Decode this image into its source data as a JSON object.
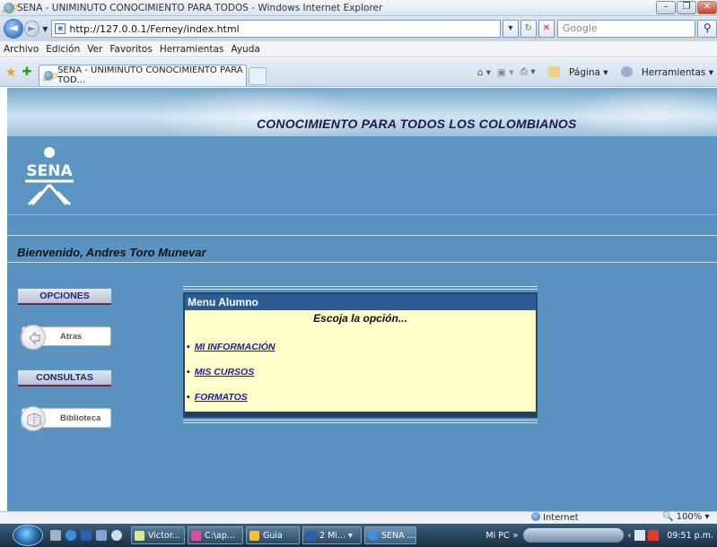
{
  "window": {
    "title": "SENA - UNIMINUTO CONOCIMIENTO PARA TODOS - Windows Internet Explorer",
    "minimize": "–",
    "maximize": "❐",
    "close": "✕"
  },
  "address_bar": {
    "url": "http://127.0.0.1/Ferney/index.html",
    "search_placeholder": "Google"
  },
  "menu": {
    "items": [
      "Archivo",
      "Edición",
      "Ver",
      "Favoritos",
      "Herramientas",
      "Ayuda"
    ]
  },
  "tab": {
    "label": "SENA - UNIMINUTO CONOCIMIENTO PARA TOD..."
  },
  "commands": {
    "page": "Página",
    "tools": "Herramientas"
  },
  "page": {
    "banner_title": "CONOCIMIENTO PARA TODOS LOS COLOMBIANOS",
    "logo_text": "SENA",
    "welcome": "Bienvenido, Andres Toro Munevar",
    "sidebar": {
      "options_header": "OPCIONES",
      "back_button": "Atras",
      "queries_header": "CONSULTAS",
      "library_button": "Biblioteca"
    },
    "student_menu": {
      "title": "Menu Alumno",
      "prompt": "Escoja la opción...",
      "items": [
        "MI INFORMACIÓN",
        "MIS CURSOS",
        "FORMATOS"
      ]
    }
  },
  "status_bar": {
    "zone": "Internet",
    "zoom": "100%"
  },
  "taskbar": {
    "tasks": [
      "Victor...",
      "C:\\ap...",
      "Guia",
      "2 Mi...",
      "SENA ..."
    ],
    "tray_label": "Mi PC",
    "clock": "09:51 p.m."
  },
  "colors": {
    "page_blue": "#5a93c0",
    "menu_header": "#2b5d93",
    "menu_bg": "#ffffcc",
    "link": "#1a1aa8"
  }
}
